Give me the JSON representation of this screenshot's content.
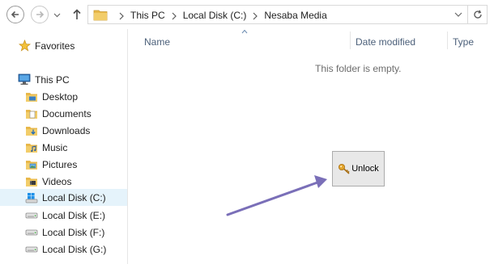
{
  "address_bar": {
    "breadcrumbs": [
      {
        "label": "This PC"
      },
      {
        "label": "Local Disk (C:)"
      },
      {
        "label": "Nesaba Media"
      }
    ]
  },
  "navigation": {
    "favorites_label": "Favorites",
    "this_pc_label": "This PC",
    "items": [
      {
        "label": "Desktop",
        "icon": "desktop-folder-icon"
      },
      {
        "label": "Documents",
        "icon": "documents-folder-icon"
      },
      {
        "label": "Downloads",
        "icon": "downloads-folder-icon"
      },
      {
        "label": "Music",
        "icon": "music-folder-icon"
      },
      {
        "label": "Pictures",
        "icon": "pictures-folder-icon"
      },
      {
        "label": "Videos",
        "icon": "videos-folder-icon"
      },
      {
        "label": "Local Disk (C:)",
        "icon": "windows-drive-icon",
        "selected": true
      },
      {
        "label": "Local Disk (E:)",
        "icon": "drive-icon"
      },
      {
        "label": "Local Disk (F:)",
        "icon": "drive-icon"
      },
      {
        "label": "Local Disk (G:)",
        "icon": "drive-icon"
      }
    ]
  },
  "content": {
    "columns": {
      "name": "Name",
      "date_modified": "Date modified",
      "type": "Type"
    },
    "empty_message": "This folder is empty.",
    "unlock_button_label": "Unlock"
  },
  "colors": {
    "accent_selected": "#e5f3fb",
    "column_header_text": "#4c607a",
    "annotation_arrow": "#7a6fb8",
    "folder_yellow": "#e8b84a"
  }
}
